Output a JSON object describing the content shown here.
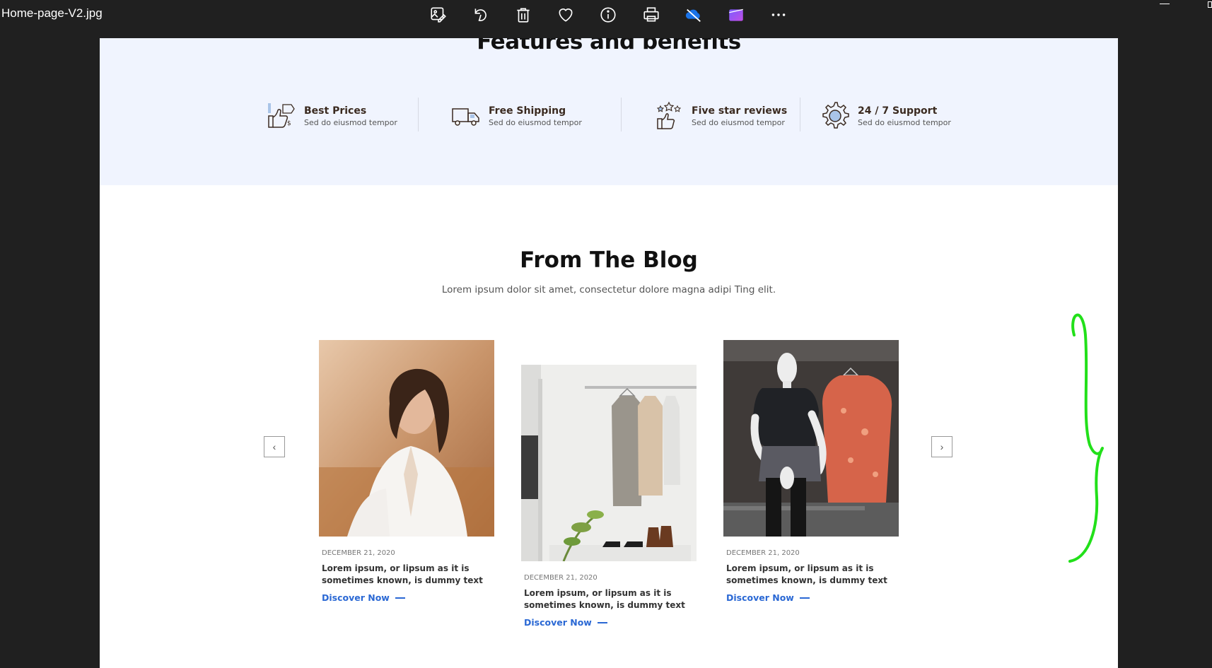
{
  "titlebar": {
    "filename": "Home-page-V2.jpg",
    "icons": [
      "edit-image-icon",
      "rotate-icon",
      "delete-icon",
      "favorite-icon",
      "info-icon",
      "print-icon",
      "onedrive-icon",
      "clipchamp-icon",
      "more-icon"
    ]
  },
  "features": {
    "title": "Features and benefits",
    "items": [
      {
        "name": "Best Prices",
        "desc": "Sed do eiusmod tempor"
      },
      {
        "name": "Free Shipping",
        "desc": "Sed do eiusmod tempor"
      },
      {
        "name": "Five star reviews",
        "desc": "Sed do eiusmod tempor"
      },
      {
        "name": "24 / 7 Support",
        "desc": "Sed do eiusmod tempor"
      }
    ]
  },
  "blog": {
    "title": "From The Blog",
    "subtitle": "Lorem ipsum dolor sit amet, consectetur dolore magna adipi Ting elit.",
    "posts": [
      {
        "date": "DECEMBER 21, 2020",
        "title": "Lorem ipsum, or lipsum as it is sometimes known, is dummy text",
        "link": "Discover Now"
      },
      {
        "date": "DECEMBER 21, 2020",
        "title": "Lorem ipsum, or lipsum as it is sometimes known, is dummy text",
        "link": "Discover Now"
      },
      {
        "date": "DECEMBER 21, 2020",
        "title": "Lorem ipsum, or lipsum as it is sometimes known, is dummy text",
        "link": "Discover Now"
      }
    ],
    "prev": "‹",
    "next": "›"
  },
  "colors": {
    "accent": "#2a68d4",
    "annotation": "#22e01a",
    "features_bg": "#f0f4fe"
  }
}
